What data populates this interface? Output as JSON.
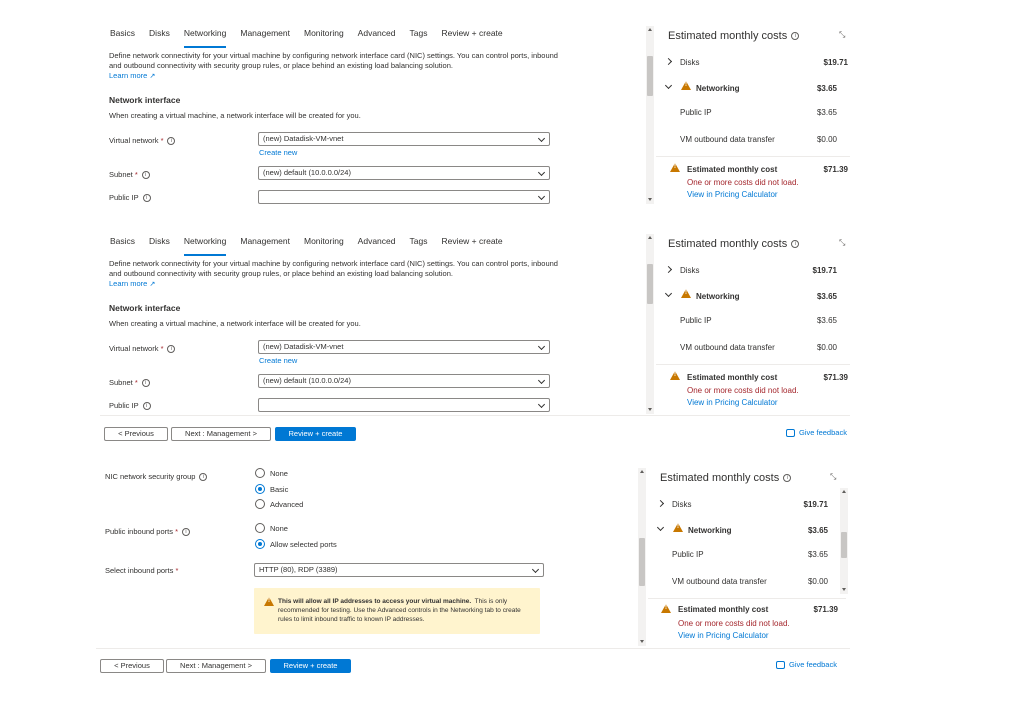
{
  "tabs": [
    "Basics",
    "Disks",
    "Networking",
    "Management",
    "Monitoring",
    "Advanced",
    "Tags",
    "Review + create"
  ],
  "description": "Define network connectivity for your virtual machine by configuring network interface card (NIC) settings. You can control ports, inbound and outbound connectivity with security group rules, or place behind an existing load balancing solution.",
  "learn_more": "Learn more",
  "network_interface_title": "Network interface",
  "network_interface_note": "When creating a virtual machine, a network interface will be created for you.",
  "fields": {
    "virtual_network_label": "Virtual network",
    "virtual_network_value": "(new) Datadisk-VM-vnet",
    "create_new": "Create new",
    "subnet_label": "Subnet",
    "subnet_value": "(new) default (10.0.0.0/24)",
    "public_ip_label": "Public IP",
    "public_ip_value": "",
    "required_mark": "*"
  },
  "nsg": {
    "label": "NIC network security group",
    "options": [
      "None",
      "Basic",
      "Advanced"
    ],
    "selected": "Basic"
  },
  "inbound": {
    "label": "Public inbound ports",
    "options": [
      "None",
      "Allow selected ports"
    ],
    "selected": "Allow selected ports",
    "select_label": "Select inbound ports",
    "select_value": "HTTP (80), RDP (3389)"
  },
  "warning": {
    "bold": "This will allow all IP addresses to access your virtual machine.",
    "rest": "This is only recommended for testing.  Use the Advanced controls in the Networking tab to create rules to limit inbound traffic to known IP addresses."
  },
  "buttons": {
    "previous": "< Previous",
    "next": "Next : Management >",
    "review": "Review + create",
    "feedback": "Give feedback"
  },
  "costs": {
    "title": "Estimated monthly costs",
    "disks_label": "Disks",
    "disks_value": "$19.71",
    "networking_label": "Networking",
    "networking_value": "$3.65",
    "public_ip_label": "Public IP",
    "public_ip_value": "$3.65",
    "outbound_label": "VM outbound data transfer",
    "outbound_value": "$0.00",
    "estimated_label": "Estimated monthly cost",
    "estimated_value": "$71.39",
    "error": "One or more costs did not load.",
    "calculator": "View in Pricing Calculator"
  },
  "colors": {
    "accent": "#0078d4",
    "warning": "#c87800",
    "error": "#a4262c",
    "warning_bg": "#fff4ce"
  }
}
